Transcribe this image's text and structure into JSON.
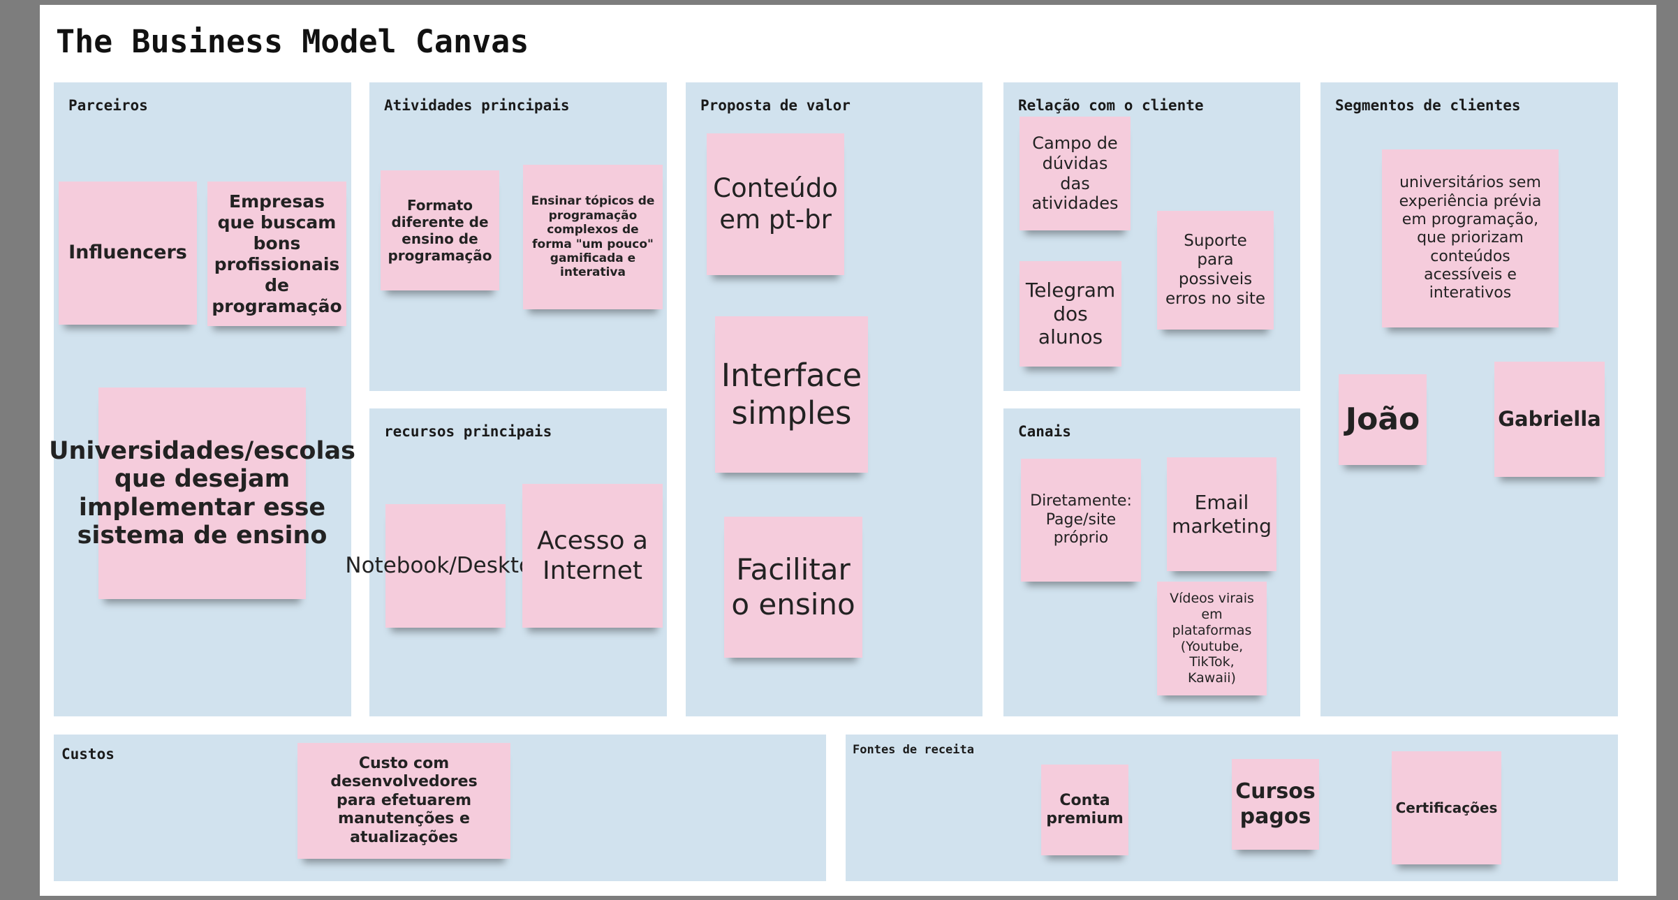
{
  "title": "The Business Model Canvas",
  "colors": {
    "panel": "#d1e2ee",
    "note": "#f5ccdc",
    "frame": "#7d7d7d"
  },
  "sections": {
    "parceiros": {
      "title": "Parceiros",
      "notes": [
        "Influencers",
        "Empresas que buscam bons profissionais de programação",
        "Universidades/escolas que desejam implementar esse sistema de ensino"
      ]
    },
    "atividades": {
      "title": "Atividades principais",
      "notes": [
        "Formato diferente de ensino de programação",
        "Ensinar tópicos de programação complexos de forma \"um pouco\" gamificada e interativa"
      ]
    },
    "recursos": {
      "title": "recursos principais",
      "notes": [
        "Notebook/Desktop",
        "Acesso a Internet"
      ]
    },
    "proposta": {
      "title": "Proposta de valor",
      "notes": [
        "Conteúdo em pt-br",
        "Interface simples",
        "Facilitar o ensino"
      ]
    },
    "relacao": {
      "title": "Relação com o cliente",
      "notes": [
        "Campo de dúvidas das atividades",
        "Suporte para possiveis erros no site",
        "Telegram dos alunos"
      ]
    },
    "canais": {
      "title": "Canais",
      "notes": [
        "Diretamente: Page/site próprio",
        "Email marketing",
        "Vídeos virais em plataformas (Youtube, TikTok, Kawaii)"
      ]
    },
    "segmentos": {
      "title": "Segmentos de clientes",
      "notes": [
        "universitários sem experiência prévia em programação, que priorizam conteúdos acessíveis e interativos",
        "João",
        "Gabriella"
      ]
    },
    "custos": {
      "title": "Custos",
      "notes": [
        "Custo com desenvolvedores para efetuarem manutenções e atualizações"
      ]
    },
    "receita": {
      "title": "Fontes de receita",
      "notes": [
        "Conta premium",
        "Cursos pagos",
        "Certificações"
      ]
    }
  }
}
